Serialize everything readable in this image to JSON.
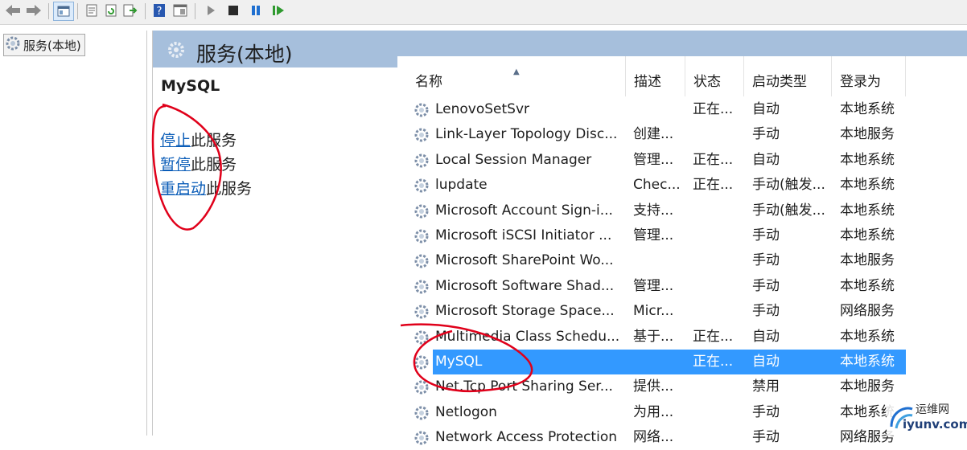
{
  "toolbar": {
    "buttons": [
      "back-icon",
      "forward-icon",
      "show-hide-tree-icon",
      "properties-icon",
      "refresh-icon",
      "export-list-icon",
      "help-icon",
      "view-icon",
      "start-icon",
      "stop-icon",
      "pause-icon",
      "resume-icon"
    ]
  },
  "tree": {
    "root_label": "服务(本地)"
  },
  "panel": {
    "title": "服务(本地)",
    "selected_service": "MySQL",
    "actions": [
      {
        "link": "停止",
        "suffix": "此服务"
      },
      {
        "link": "暂停",
        "suffix": "此服务"
      },
      {
        "link": "重启动",
        "suffix": "此服务"
      }
    ]
  },
  "table": {
    "headers": [
      "名称",
      "描述",
      "状态",
      "启动类型",
      "登录为"
    ],
    "rows": [
      {
        "name": "LenovoSetSvr",
        "desc": "",
        "status": "正在...",
        "startup": "自动",
        "logon": "本地系统"
      },
      {
        "name": "Link-Layer Topology Disc...",
        "desc": "创建...",
        "status": "",
        "startup": "手动",
        "logon": "本地服务"
      },
      {
        "name": "Local Session Manager",
        "desc": "管理...",
        "status": "正在...",
        "startup": "自动",
        "logon": "本地系统"
      },
      {
        "name": "lupdate",
        "desc": "Chec...",
        "status": "正在...",
        "startup": "手动(触发...",
        "logon": "本地系统"
      },
      {
        "name": "Microsoft Account Sign-i...",
        "desc": "支持...",
        "status": "",
        "startup": "手动(触发...",
        "logon": "本地系统"
      },
      {
        "name": "Microsoft iSCSI Initiator ...",
        "desc": "管理...",
        "status": "",
        "startup": "手动",
        "logon": "本地系统"
      },
      {
        "name": "Microsoft SharePoint Wo...",
        "desc": "",
        "status": "",
        "startup": "手动",
        "logon": "本地服务"
      },
      {
        "name": "Microsoft Software Shad...",
        "desc": "管理...",
        "status": "",
        "startup": "手动",
        "logon": "本地系统"
      },
      {
        "name": "Microsoft Storage Space...",
        "desc": "Micr...",
        "status": "",
        "startup": "手动",
        "logon": "网络服务"
      },
      {
        "name": "Multimedia Class Schedu...",
        "desc": "基于...",
        "status": "正在...",
        "startup": "自动",
        "logon": "本地系统"
      },
      {
        "name": "MySQL",
        "desc": "",
        "status": "正在...",
        "startup": "自动",
        "logon": "本地系统",
        "selected": true
      },
      {
        "name": "Net.Tcp Port Sharing Ser...",
        "desc": "提供...",
        "status": "",
        "startup": "禁用",
        "logon": "本地服务"
      },
      {
        "name": "Netlogon",
        "desc": "为用...",
        "status": "",
        "startup": "手动",
        "logon": "本地系统"
      },
      {
        "name": "Network Access Protection",
        "desc": "网络...",
        "status": "",
        "startup": "手动",
        "logon": "网络服务"
      }
    ]
  },
  "colors": {
    "header_bg": "#a6bfdc",
    "selection": "#3399ff",
    "link": "#0b5db8",
    "annotation": "#e0001a"
  },
  "watermark": {
    "line1": "运维网",
    "line2": "iyunv.com"
  }
}
